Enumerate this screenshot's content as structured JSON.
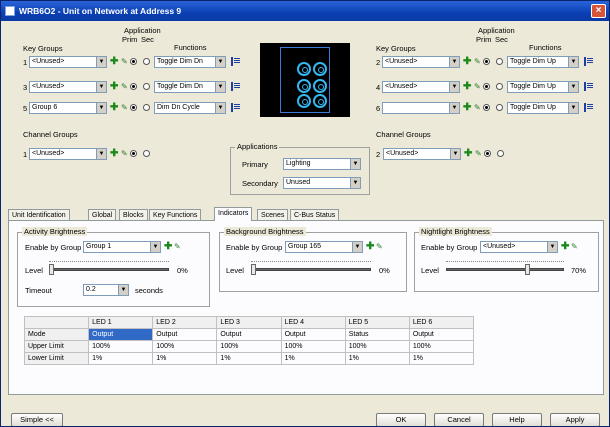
{
  "window": {
    "title": "WRB6O2 - Unit on Network at Address 9",
    "close_glyph": "×"
  },
  "left_key_groups": {
    "heading": "Key Groups",
    "application_heading": "Application",
    "prim": "Prim",
    "sec": "Sec",
    "functions_heading": "Functions",
    "rows": [
      {
        "num": "1",
        "group": "<Unused>",
        "function": "Toggle Dim Dn"
      },
      {
        "num": "3",
        "group": "<Unused>",
        "function": "Toggle Dim Dn"
      },
      {
        "num": "5",
        "group": "Group 6",
        "function": "Dim Dn Cycle"
      }
    ]
  },
  "right_key_groups": {
    "heading": "Key Groups",
    "application_heading": "Application",
    "prim": "Prim",
    "sec": "Sec",
    "functions_heading": "Functions",
    "rows": [
      {
        "num": "2",
        "group": "<Unused>",
        "function": "Toggle Dim Up"
      },
      {
        "num": "4",
        "group": "<Unused>",
        "function": "Toggle Dim Up"
      },
      {
        "num": "6",
        "group": "",
        "function": "Toggle Dim Up"
      }
    ]
  },
  "left_channel_groups": {
    "heading": "Channel Groups",
    "num": "1",
    "group": "<Unused>"
  },
  "right_channel_groups": {
    "heading": "Channel Groups",
    "num": "2",
    "group": "<Unused>"
  },
  "applications": {
    "heading": "Applications",
    "primary_label": "Primary",
    "primary_value": "Lighting",
    "secondary_label": "Secondary",
    "secondary_value": "Unused"
  },
  "tabs": [
    {
      "label": "Unit Identification"
    },
    {
      "label": "Global"
    },
    {
      "label": "Blocks"
    },
    {
      "label": "Key Functions"
    },
    {
      "label": "Indicators",
      "selected": true
    },
    {
      "label": "Scenes"
    },
    {
      "label": "C-Bus Status"
    }
  ],
  "activity": {
    "title": "Activity Brightness",
    "enable_label": "Enable by Group",
    "group": "Group 1",
    "level_label": "Level",
    "level_value": "0%",
    "level_fraction": 0,
    "timeout_label": "Timeout",
    "timeout_value": "0.2",
    "timeout_unit": "seconds"
  },
  "background": {
    "title": "Background Brightness",
    "enable_label": "Enable by Group",
    "group": "Group 165",
    "level_label": "Level",
    "level_value": "0%",
    "level_fraction": 0
  },
  "nightlight": {
    "title": "Nightlight Brightness",
    "enable_label": "Enable by Group",
    "group": "<Unused>",
    "level_label": "Level",
    "level_value": "70%",
    "level_fraction": 0.7
  },
  "led_table": {
    "columns": [
      "",
      "LED 1",
      "LED 2",
      "LED 3",
      "LED 4",
      "LED 5",
      "LED 6"
    ],
    "rows": [
      {
        "label": "Mode",
        "cells": [
          "Output",
          "Output",
          "Output",
          "Output",
          "Status",
          "Output"
        ]
      },
      {
        "label": "Upper Limit",
        "cells": [
          "100%",
          "100%",
          "100%",
          "100%",
          "100%",
          "100%"
        ]
      },
      {
        "label": "Lower Limit",
        "cells": [
          "1%",
          "1%",
          "1%",
          "1%",
          "1%",
          "1%"
        ]
      }
    ]
  },
  "buttons": {
    "simple": "Simple <<",
    "ok": "OK",
    "cancel": "Cancel",
    "help": "Help",
    "apply": "Apply"
  },
  "icons": {
    "add": "plus-icon",
    "edit": "pencil-icon",
    "functions": "function-list-icon"
  }
}
